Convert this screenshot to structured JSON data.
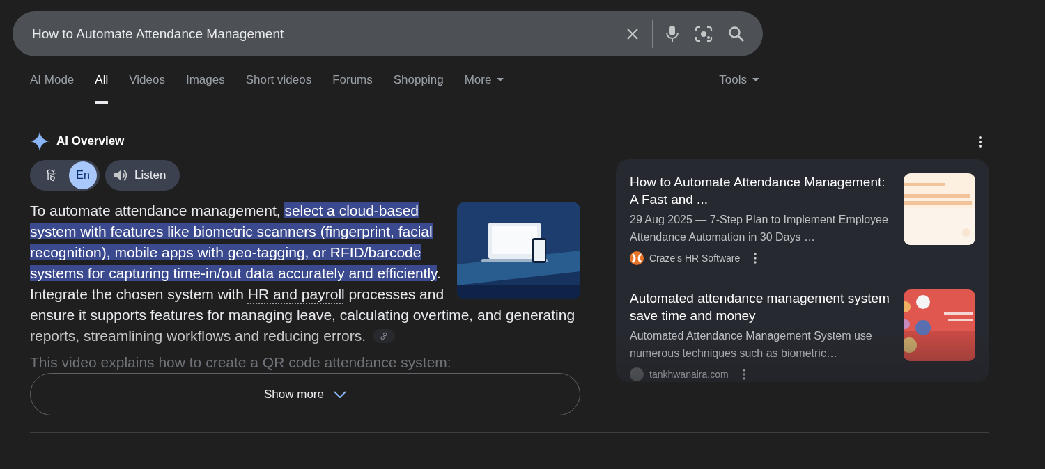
{
  "search": {
    "value": "How to Automate Attendance Management"
  },
  "tabs": [
    {
      "label": "AI Mode",
      "selected": false
    },
    {
      "label": "All",
      "selected": true
    },
    {
      "label": "Videos",
      "selected": false
    },
    {
      "label": "Images",
      "selected": false
    },
    {
      "label": "Short videos",
      "selected": false
    },
    {
      "label": "Forums",
      "selected": false
    },
    {
      "label": "Shopping",
      "selected": false
    },
    {
      "label": "More",
      "selected": false,
      "kind": "menu"
    }
  ],
  "tools": {
    "label": "Tools"
  },
  "overview": {
    "title": "AI Overview",
    "languages": [
      {
        "label": "हिं",
        "selected": false
      },
      {
        "label": "En",
        "selected": true
      }
    ],
    "listen": "Listen",
    "paragraph": [
      {
        "text": "To automate attendance management, ",
        "kind": "plain"
      },
      {
        "text": "select a cloud-based system with features like biometric scanners (fingerprint, facial recognition), mobile apps with geo-tagging, or RFID/barcode systems for capturing time-in/out data accurately and efficiently",
        "kind": "highlight"
      },
      {
        "text": ". Integrate the chosen system with ",
        "kind": "plain"
      },
      {
        "text": "HR and payroll",
        "kind": "term"
      },
      {
        "text": " processes and ensure it supports features for managing leave, calculating overtime, and generating reports, streamlining workflows and reducing errors.",
        "kind": "plain"
      }
    ],
    "video_line": "This video explains how to create a QR code attendance system:",
    "show_more": "Show more",
    "sources": [
      {
        "title": "How to Automate Attendance Management: A Fast and ...",
        "snippet": "29 Aug 2025 — 7-Step Plan to Implement Employee Attendance Automation in 30 Days …",
        "site": "Craze's HR Software"
      },
      {
        "title": "Automated attendance management system save time and money",
        "snippet": "Automated Attendance Management System use numerous techniques such as biometric…",
        "site": "tankhwanaira.com"
      }
    ]
  }
}
